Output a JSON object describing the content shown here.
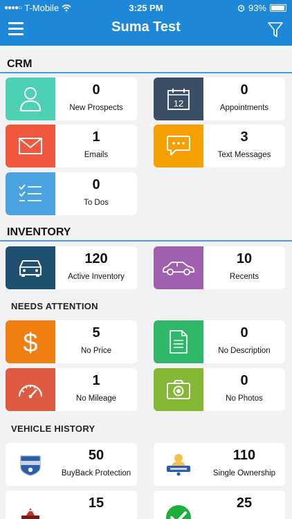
{
  "status": {
    "carrier": "T-Mobile",
    "time": "3:25 PM",
    "battery": "93%"
  },
  "nav": {
    "title": "Suma Test",
    "menu_icon": "hamburger-icon",
    "filter_icon": "filter-icon"
  },
  "crm": {
    "title": "CRM",
    "cards": [
      {
        "count": "0",
        "label": "New Prospects",
        "icon": "person-icon",
        "color": "#4dd0b4"
      },
      {
        "count": "0",
        "label": "Appointments",
        "icon": "calendar-icon",
        "color": "#3c4e63",
        "day": "12"
      },
      {
        "count": "1",
        "label": "Emails",
        "icon": "envelope-icon",
        "color": "#f0573d"
      },
      {
        "count": "3",
        "label": "Text Messages",
        "icon": "chat-icon",
        "color": "#f5a000"
      },
      {
        "count": "0",
        "label": "To Dos",
        "icon": "checklist-icon",
        "color": "#4aa3e0"
      }
    ]
  },
  "inventory": {
    "title": "INVENTORY",
    "cards": [
      {
        "count": "120",
        "label": "Active Inventory",
        "icon": "car-front-icon",
        "color": "#1f5070"
      },
      {
        "count": "10",
        "label": "Recents",
        "icon": "car-side-icon",
        "color": "#a060b0"
      }
    ]
  },
  "needs_attention": {
    "title": "NEEDS ATTENTION",
    "cards": [
      {
        "count": "5",
        "label": "No Price",
        "icon": "dollar-icon",
        "color": "#f07e10"
      },
      {
        "count": "0",
        "label": "No Description",
        "icon": "document-icon",
        "color": "#2fb86a"
      },
      {
        "count": "1",
        "label": "No Mileage",
        "icon": "speedometer-icon",
        "color": "#de5a40"
      },
      {
        "count": "0",
        "label": "No Photos",
        "icon": "camera-icon",
        "color": "#84b832"
      }
    ]
  },
  "vehicle_history": {
    "title": "VEHICLE HISTORY",
    "cards": [
      {
        "count": "50",
        "label": "BuyBack Protection",
        "icon": "buyback-badge-icon"
      },
      {
        "count": "110",
        "label": "Single Ownership",
        "icon": "owner-badge-icon"
      },
      {
        "count": "15",
        "label": "",
        "icon": "accident-badge-icon"
      },
      {
        "count": "25",
        "label": "",
        "icon": "check-circle-icon",
        "color": "#1fae3c"
      }
    ]
  }
}
